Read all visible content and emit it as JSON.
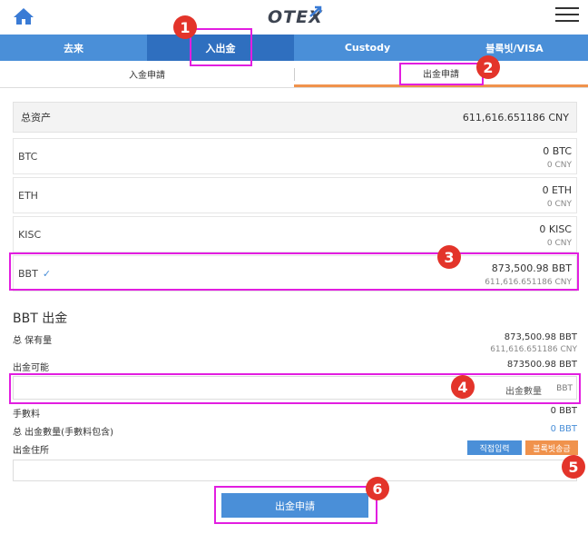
{
  "header": {
    "logo": "OTEX"
  },
  "nav": {
    "tabs": [
      {
        "label": "去来"
      },
      {
        "label": "入出金"
      },
      {
        "label": "Custody"
      },
      {
        "label": "블록빗/VISA"
      }
    ]
  },
  "subtabs": [
    {
      "label": "入金申請"
    },
    {
      "label": "出金申請"
    }
  ],
  "total": {
    "label": "总资产",
    "value": "611,616.651186 CNY"
  },
  "coins": [
    {
      "name": "BTC",
      "amount": "0 BTC",
      "cny": "0 CNY"
    },
    {
      "name": "ETH",
      "amount": "0 ETH",
      "cny": "0 CNY"
    },
    {
      "name": "KISC",
      "amount": "0 KISC",
      "cny": "0 CNY"
    },
    {
      "name": "BBT",
      "amount": "873,500.98 BBT",
      "cny": "611,616.651186 CNY"
    }
  ],
  "withdraw": {
    "title": "BBT 出金",
    "holdings_label": "总 保有量",
    "holdings_value": "873,500.98 BBT",
    "holdings_cny": "611,616.651186 CNY",
    "available_label": "出金可能",
    "available_value": "873500.98 BBT",
    "amount_placeholder": "出金數量",
    "amount_unit": "BBT",
    "fee_label": "手數料",
    "fee_value": "0 BBT",
    "total_label": "总 出金數量(手數料包含)",
    "total_value": "0 BBT",
    "address_label": "出金住所",
    "btn_direct": "직접입력",
    "btn_block": "블록빗송금",
    "submit": "出金申請"
  },
  "markers": [
    "1",
    "2",
    "3",
    "4",
    "5",
    "6"
  ],
  "colors": {
    "primary": "#4a8fd8",
    "accent": "#f0924c",
    "highlight": "#e21ee0",
    "marker": "#e3342a"
  }
}
